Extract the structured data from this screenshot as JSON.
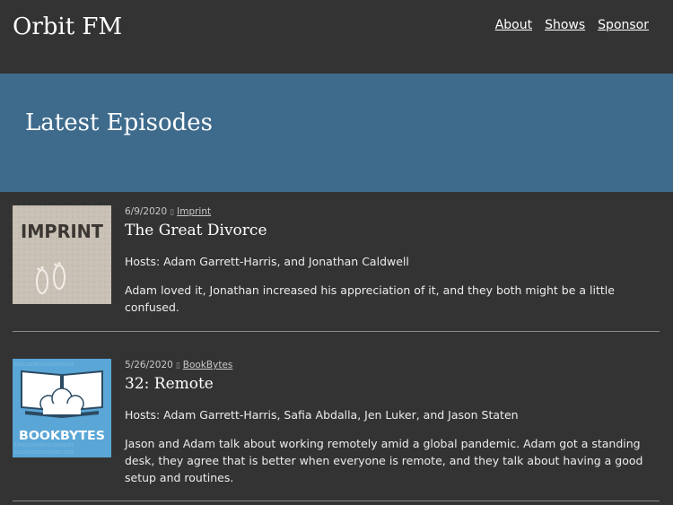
{
  "site": {
    "title": "Orbit FM",
    "nav": [
      {
        "label": "About"
      },
      {
        "label": "Shows"
      },
      {
        "label": "Sponsor"
      }
    ]
  },
  "hero": {
    "heading": "Latest Episodes"
  },
  "episodes": [
    {
      "date": "6/9/2020",
      "separator": "▯",
      "show": "Imprint",
      "title": "The Great Divorce",
      "hosts": "Hosts: Adam Garrett-Harris, and Jonathan Caldwell",
      "summary": "Adam loved it, Jonathan increased his appreciation of it, and they both might be a little confused.",
      "cover_text": "IMPRINT"
    },
    {
      "date": "5/26/2020",
      "separator": "▯",
      "show": "BookBytes",
      "title": "32: Remote",
      "hosts": "Hosts: Adam Garrett-Harris, Safia Abdalla, Jen Luker, and Jason Staten",
      "summary": "Jason and Adam talk about working remotely amid a global pandemic. Adam got a standing desk, they agree that is better when everyone is remote, and they talk about having a good setup and routines.",
      "cover_text": "BOOKBYTES"
    }
  ],
  "colors": {
    "background": "#333333",
    "hero": "#3e6b8c",
    "bookbytes_cover": "#5aa6d6",
    "imprint_cover": "#c9c1b5"
  }
}
